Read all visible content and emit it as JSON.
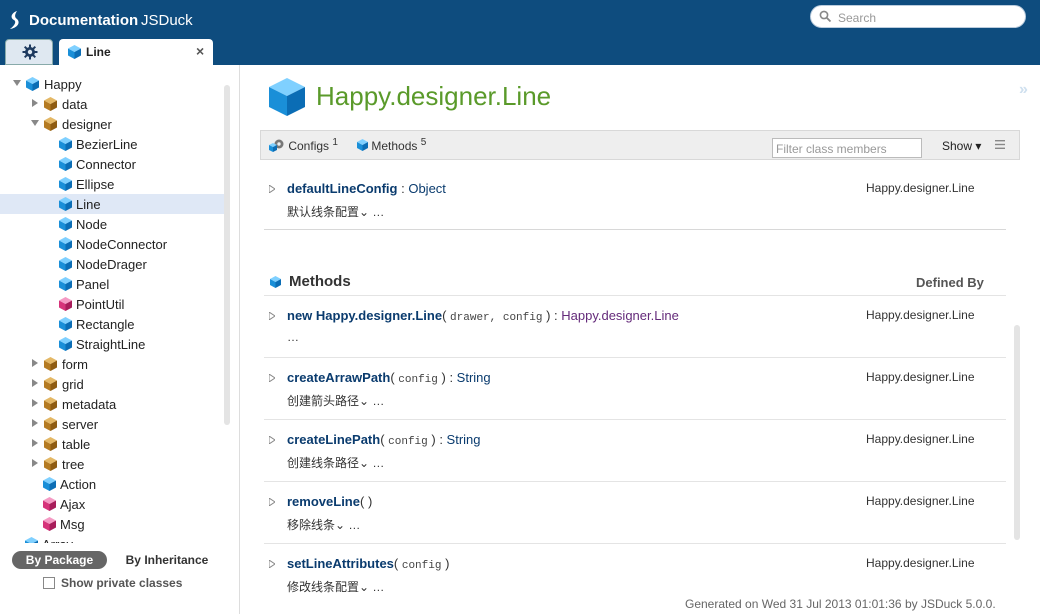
{
  "app": {
    "title": "Documentation",
    "subtitle": "JSDuck"
  },
  "search": {
    "placeholder": "Search"
  },
  "tabs": {
    "active_label": "Line"
  },
  "sidebar": {
    "tree": [
      {
        "label": "Happy",
        "depth": 0,
        "kind": "pkg-root",
        "expanded": true
      },
      {
        "label": "data",
        "depth": 1,
        "kind": "package",
        "expanded": false
      },
      {
        "label": "designer",
        "depth": 1,
        "kind": "package",
        "expanded": true
      },
      {
        "label": "BezierLine",
        "depth": 2,
        "kind": "class"
      },
      {
        "label": "Connector",
        "depth": 2,
        "kind": "class"
      },
      {
        "label": "Ellipse",
        "depth": 2,
        "kind": "class"
      },
      {
        "label": "Line",
        "depth": 2,
        "kind": "class",
        "selected": true
      },
      {
        "label": "Node",
        "depth": 2,
        "kind": "class"
      },
      {
        "label": "NodeConnector",
        "depth": 2,
        "kind": "class"
      },
      {
        "label": "NodeDrager",
        "depth": 2,
        "kind": "class"
      },
      {
        "label": "Panel",
        "depth": 2,
        "kind": "class"
      },
      {
        "label": "PointUtil",
        "depth": 2,
        "kind": "singleton"
      },
      {
        "label": "Rectangle",
        "depth": 2,
        "kind": "class"
      },
      {
        "label": "StraightLine",
        "depth": 2,
        "kind": "class"
      },
      {
        "label": "form",
        "depth": 1,
        "kind": "package",
        "expanded": false
      },
      {
        "label": "grid",
        "depth": 1,
        "kind": "package",
        "expanded": false
      },
      {
        "label": "metadata",
        "depth": 1,
        "kind": "package",
        "expanded": false
      },
      {
        "label": "server",
        "depth": 1,
        "kind": "package",
        "expanded": false
      },
      {
        "label": "table",
        "depth": 1,
        "kind": "package",
        "expanded": false
      },
      {
        "label": "tree",
        "depth": 1,
        "kind": "package",
        "expanded": false
      },
      {
        "label": "Action",
        "depth": 1,
        "kind": "class"
      },
      {
        "label": "Ajax",
        "depth": 1,
        "kind": "singleton"
      },
      {
        "label": "Msg",
        "depth": 1,
        "kind": "singleton"
      },
      {
        "label": "Array",
        "depth": 0,
        "kind": "class"
      }
    ],
    "by_package": "By Package",
    "by_inheritance": "By Inheritance",
    "show_private": "Show private classes"
  },
  "main": {
    "class_title": "Happy.designer.Line",
    "toolbar": {
      "configs": "Configs",
      "configs_count": "1",
      "methods": "Methods",
      "methods_count": "5",
      "filter_placeholder": "Filter class members",
      "show": "Show ▾"
    },
    "config": {
      "name": "defaultLineConfig",
      "sep": " : ",
      "type": "Object",
      "owner": "Happy.designer.Line",
      "short": "默认线条配置⌄ …"
    },
    "methods_header": {
      "title": "Methods",
      "defined_by": "Defined By"
    },
    "methods": [
      {
        "prefix": "new ",
        "name": "Happy.designer.Line",
        "params": "drawer, config",
        "ret": "Happy.designer.Line",
        "owner": "Happy.designer.Line",
        "short": "…"
      },
      {
        "prefix": "",
        "name": "createArrawPath",
        "params": "config",
        "ret": "String",
        "owner": "Happy.designer.Line",
        "short": "创建箭头路径⌄ …"
      },
      {
        "prefix": "",
        "name": "createLinePath",
        "params": "config",
        "ret": "String",
        "owner": "Happy.designer.Line",
        "short": "创建线条路径⌄ …"
      },
      {
        "prefix": "",
        "name": "removeLine",
        "params": "",
        "ret": "",
        "owner": "Happy.designer.Line",
        "short": "移除线条⌄ …"
      },
      {
        "prefix": "",
        "name": "setLineAttributes",
        "params": "config",
        "ret": "",
        "owner": "Happy.designer.Line",
        "short": "修改线条配置⌄ …"
      }
    ]
  },
  "footer": "Generated on Wed 31 Jul 2013 01:01:36 by JSDuck 5.0.0."
}
